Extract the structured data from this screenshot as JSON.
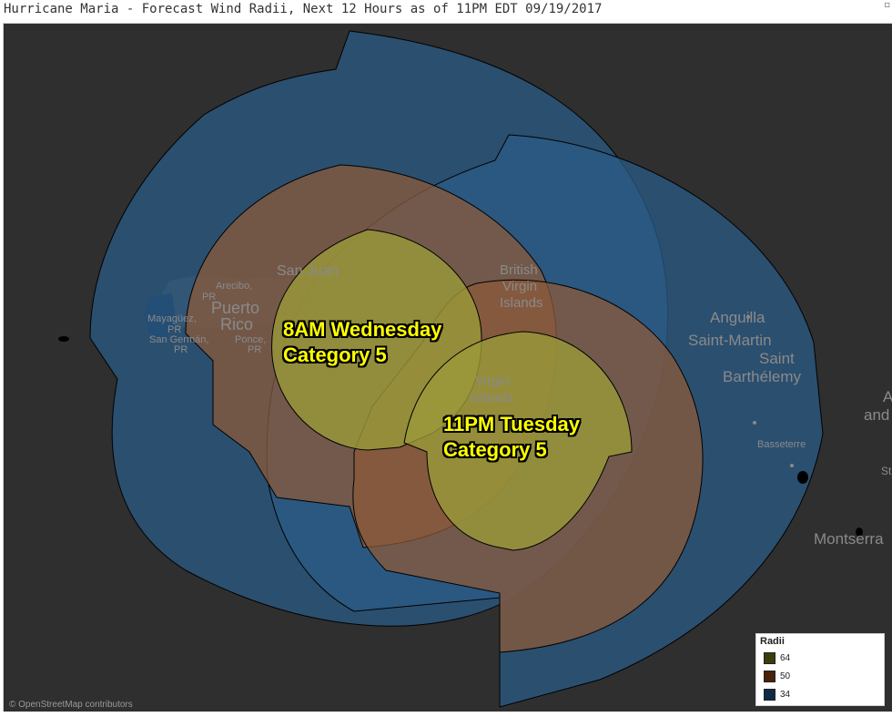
{
  "title": "Hurricane Maria - Forecast Wind Radii, Next 12 Hours as of 11PM EDT 09/19/2017",
  "attribution": "© OpenStreetMap contributors",
  "colors": {
    "map_background": "#2f2f2f",
    "r34": "#2a5a84",
    "r50": "#8b5a3a",
    "r64": "#9a9a3a",
    "label": "#ffff00"
  },
  "legend": {
    "title": "Radii",
    "items": [
      {
        "label": "64",
        "color": "#3d3d0c"
      },
      {
        "label": "50",
        "color": "#4a220c"
      },
      {
        "label": "34",
        "color": "#0f2b47"
      }
    ]
  },
  "forecasts": [
    {
      "time": "8AM Wednesday",
      "category": "Category 5"
    },
    {
      "time": "11PM Tuesday",
      "category": "Category 5"
    }
  ],
  "places": {
    "san_juan": "San Juan",
    "arecibo": "Arecibo,",
    "arecibo_pr": "PR",
    "puerto": "Puerto",
    "rico": "Rico",
    "mayaguez": "Mayagüez,",
    "mayaguez_pr": "PR",
    "san_german": "San Germán,",
    "san_german_pr": "PR",
    "ponce": "Ponce,",
    "ponce_pr": "PR",
    "bvi_1": "British",
    "bvi_2": "Virgin",
    "bvi_3": "Islands",
    "vi_1": "Virgin",
    "vi_2": "Islands",
    "anguilla": "Anguilla",
    "saint_martin": "Saint-Martin",
    "saint": "Saint",
    "barthelemy": "Barthélemy",
    "basseterre": "Basseterre",
    "montserrat": "Montserra",
    "a_edge": "A",
    "and_edge": "and",
    "st_edge": "St"
  }
}
